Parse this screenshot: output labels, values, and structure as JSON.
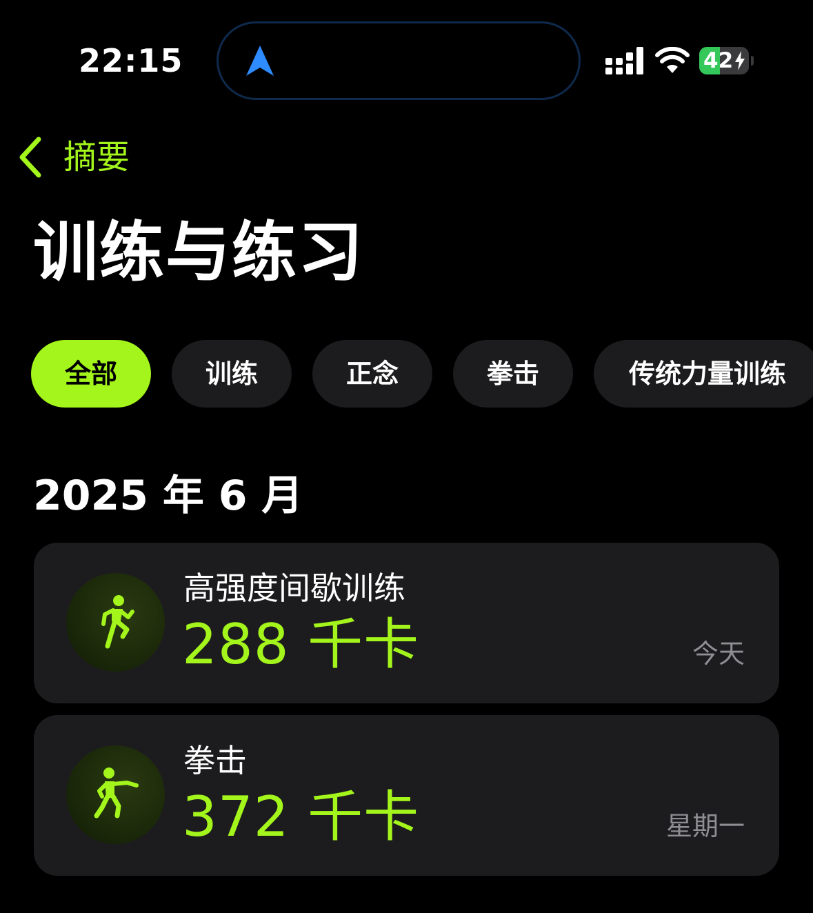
{
  "status_bar": {
    "time": "22:15",
    "battery_percent": 42,
    "battery_label": "42"
  },
  "nav": {
    "back_label": "摘要"
  },
  "page": {
    "title": "训练与练习"
  },
  "filters": [
    {
      "label": "全部",
      "active": true
    },
    {
      "label": "训练",
      "active": false
    },
    {
      "label": "正念",
      "active": false
    },
    {
      "label": "拳击",
      "active": false
    },
    {
      "label": "传统力量训练",
      "active": false
    }
  ],
  "section": {
    "header": "2025 年 6 月"
  },
  "workouts": [
    {
      "title": "高强度间歇训练",
      "value": "288 千卡",
      "date": "今天",
      "icon": "hiit-runner-icon"
    },
    {
      "title": "拳击",
      "value": "372 千卡",
      "date": "星期一",
      "icon": "boxing-figure-icon"
    }
  ],
  "colors": {
    "accent": "#a3f51b",
    "card_bg": "#1c1c1e",
    "secondary_text": "#8e8e93",
    "battery_green": "#34c759",
    "location_blue": "#2f8cff"
  }
}
